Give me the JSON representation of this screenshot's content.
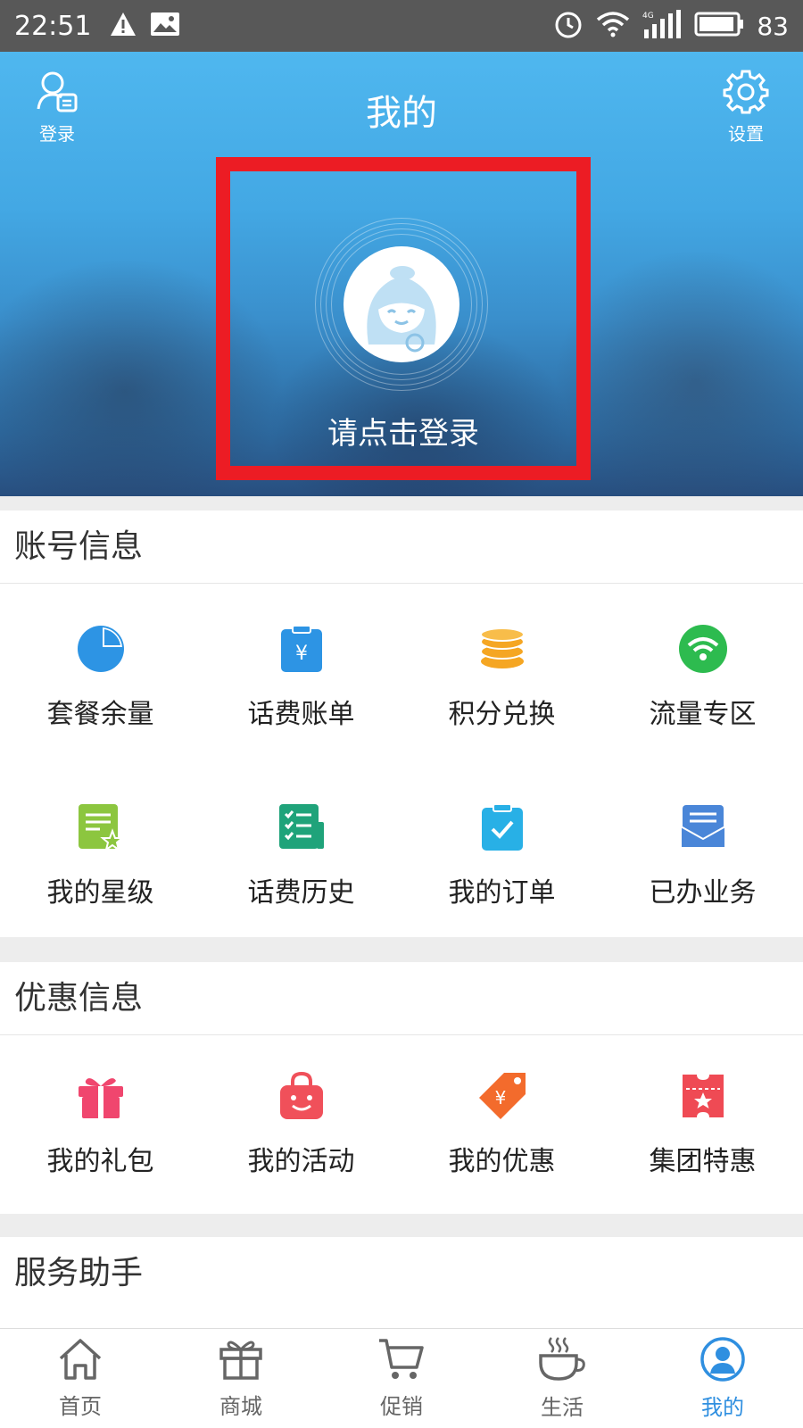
{
  "status_bar": {
    "time": "22:51",
    "battery": "83"
  },
  "header": {
    "title": "我的",
    "login_label": "登录",
    "settings_label": "设置"
  },
  "profile": {
    "login_prompt": "请点击登录"
  },
  "account_section": {
    "title": "账号信息",
    "items": [
      {
        "label": "套餐余量",
        "icon": "pie-chart-icon",
        "color": "#2d94e4"
      },
      {
        "label": "话费账单",
        "icon": "bill-icon",
        "color": "#2d94e4"
      },
      {
        "label": "积分兑换",
        "icon": "coins-icon",
        "color": "#f5a623"
      },
      {
        "label": "流量专区",
        "icon": "wifi-icon",
        "color": "#2dbb4f"
      },
      {
        "label": "我的星级",
        "icon": "star-doc-icon",
        "color": "#8cc63f"
      },
      {
        "label": "话费历史",
        "icon": "history-list-icon",
        "color": "#1fa37a"
      },
      {
        "label": "我的订单",
        "icon": "order-clipboard-icon",
        "color": "#28b0e6"
      },
      {
        "label": "已办业务",
        "icon": "envelope-icon",
        "color": "#4a86d8"
      }
    ]
  },
  "promo_section": {
    "title": "优惠信息",
    "items": [
      {
        "label": "我的礼包",
        "icon": "gift-icon",
        "color": "#f0466e"
      },
      {
        "label": "我的活动",
        "icon": "shopping-bag-icon",
        "color": "#f0505a"
      },
      {
        "label": "我的优惠",
        "icon": "price-tag-icon",
        "color": "#f36b2c"
      },
      {
        "label": "集团特惠",
        "icon": "ticket-icon",
        "color": "#ef4a54"
      }
    ]
  },
  "service_section": {
    "title": "服务助手"
  },
  "bottom_nav": {
    "items": [
      {
        "label": "首页",
        "icon": "home-icon"
      },
      {
        "label": "商城",
        "icon": "gift-box-icon"
      },
      {
        "label": "促销",
        "icon": "cart-icon"
      },
      {
        "label": "生活",
        "icon": "coffee-icon"
      },
      {
        "label": "我的",
        "icon": "profile-icon"
      }
    ],
    "active_color": "#2f8fe0"
  }
}
